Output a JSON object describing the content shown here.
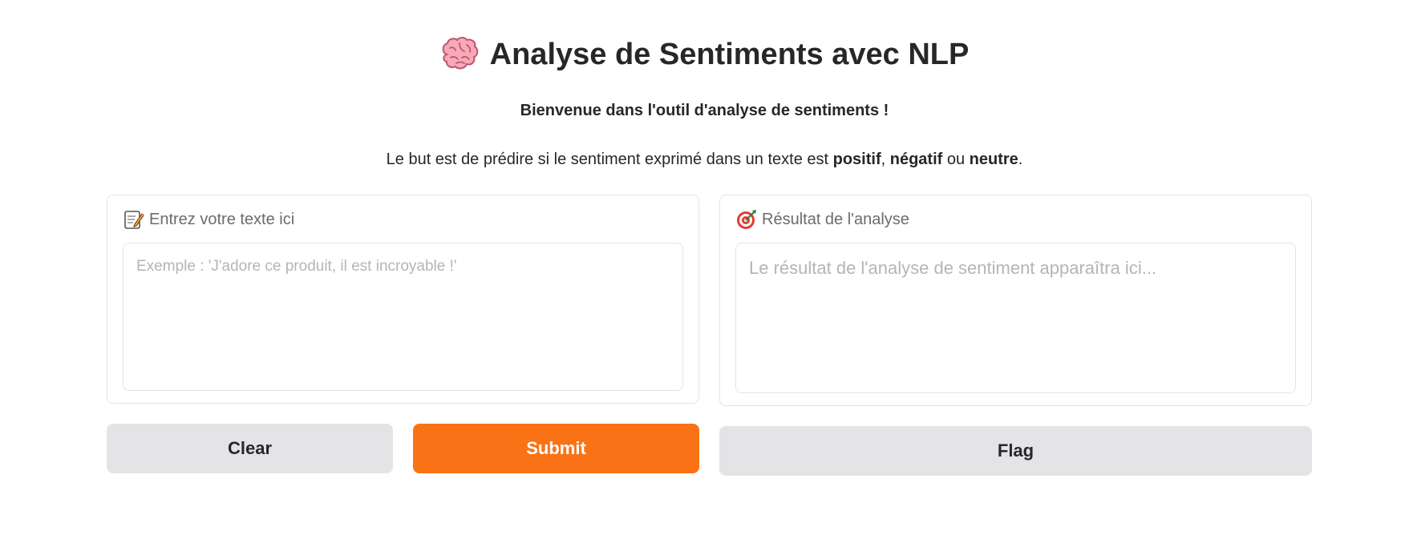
{
  "header": {
    "icon": "brain-icon",
    "title": "Analyse de Sentiments avec NLP"
  },
  "intro": {
    "welcome": "Bienvenue dans l'outil d'analyse de sentiments !",
    "desc_prefix": "Le but est de prédire si le sentiment exprimé dans un texte est ",
    "positive": "positif",
    "comma": ", ",
    "negative": "négatif",
    "or": " ou ",
    "neutral": "neutre",
    "period": "."
  },
  "input_panel": {
    "icon": "memo-icon",
    "label": "Entrez votre texte ici",
    "value": "",
    "placeholder": "Exemple : 'J'adore ce produit, il est incroyable !'"
  },
  "output_panel": {
    "icon": "target-icon",
    "label": "Résultat de l'analyse",
    "value": "",
    "placeholder": "Le résultat de l'analyse de sentiment apparaîtra ici..."
  },
  "buttons": {
    "clear": "Clear",
    "submit": "Submit",
    "flag": "Flag"
  },
  "colors": {
    "accent": "#f97316",
    "button_secondary": "#e4e4e7",
    "border": "#e4e4e7",
    "text": "#27272a",
    "muted": "#6b6b73"
  }
}
